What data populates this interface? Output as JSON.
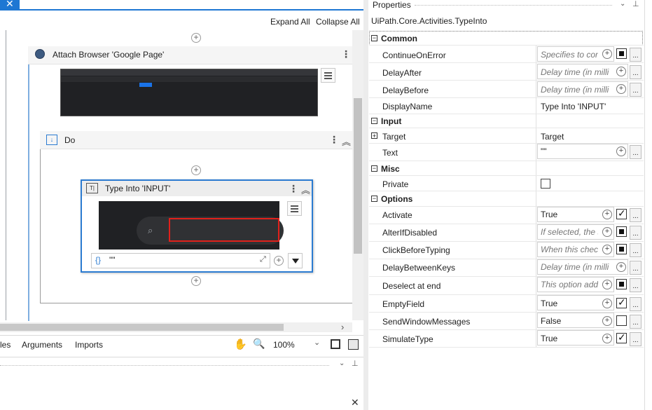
{
  "designer": {
    "toolbar": {
      "expand_all": "Expand All",
      "collapse_all": "Collapse All"
    },
    "attach_browser": {
      "title": "Attach Browser 'Google Page'"
    },
    "do_sequence": {
      "title": "Do"
    },
    "type_into": {
      "title": "Type Into 'INPUT'",
      "text_value": "\"\""
    },
    "bottom_tabs": [
      "les",
      "Arguments",
      "Imports"
    ],
    "zoom": "100%"
  },
  "properties": {
    "panel_title": "Properties",
    "activity_type": "UiPath.Core.Activities.TypeInto",
    "categories": {
      "common": "Common",
      "input": "Input",
      "misc": "Misc",
      "options": "Options"
    },
    "common": [
      {
        "name": "ContinueOnError",
        "placeholder": "Specifies to con"
      },
      {
        "name": "DelayAfter",
        "placeholder": "Delay time (in milli"
      },
      {
        "name": "DelayBefore",
        "placeholder": "Delay time (in milli"
      },
      {
        "name": "DisplayName",
        "value": "Type Into 'INPUT'"
      }
    ],
    "input": [
      {
        "name": "Target",
        "value": "Target"
      },
      {
        "name": "Text",
        "value": "\"\""
      }
    ],
    "misc": [
      {
        "name": "Private"
      }
    ],
    "options": [
      {
        "name": "Activate",
        "value": "True"
      },
      {
        "name": "AlterIfDisabled",
        "placeholder": "If selected, the s"
      },
      {
        "name": "ClickBeforeTyping",
        "placeholder": "When this chec."
      },
      {
        "name": "DelayBetweenKeys",
        "placeholder": "Delay time (in milli"
      },
      {
        "name": "Deselect at end",
        "placeholder": "This option add"
      },
      {
        "name": "EmptyField",
        "value": "True"
      },
      {
        "name": "SendWindowMessages",
        "value": "False"
      },
      {
        "name": "SimulateType",
        "value": "True"
      }
    ],
    "dots_label": "..."
  }
}
